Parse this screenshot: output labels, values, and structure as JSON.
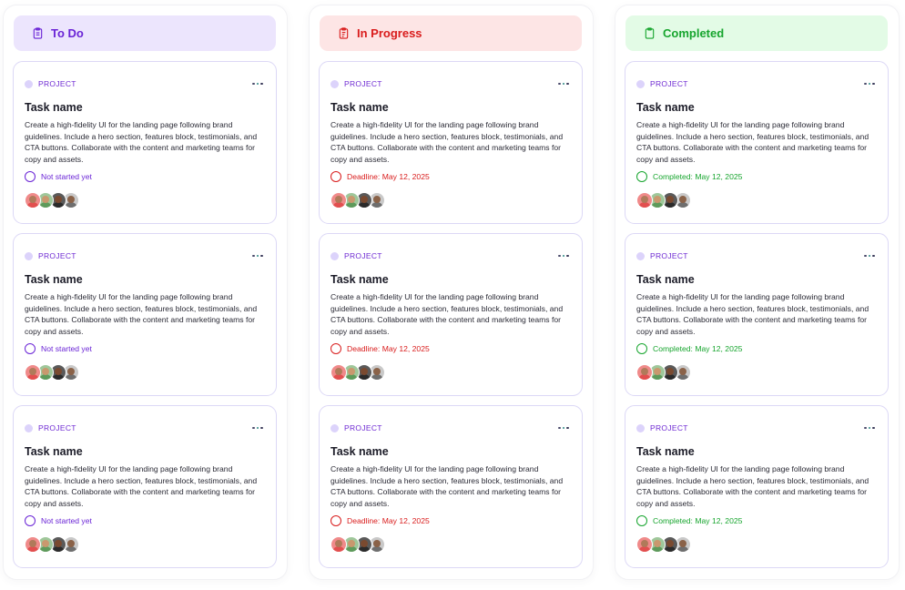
{
  "columns": [
    {
      "title": "To Do",
      "header_bg": "#ece5fd",
      "header_color": "#6a24d6",
      "icon": "clipboard-list-icon",
      "status_color": "#6a24d6",
      "cards": [
        {
          "project_label": "PROJECT",
          "title": "Task name",
          "description": "Create a high-fidelity UI for the landing page following brand guidelines. Include a hero section, features block, testimonials, and CTA buttons. Collaborate with the content and marketing teams for copy and assets.",
          "status": "Not started yet"
        },
        {
          "project_label": "PROJECT",
          "title": "Task name",
          "description": "Create a high-fidelity UI for the landing page following brand guidelines. Include a hero section, features block, testimonials, and CTA buttons. Collaborate with the content and marketing teams for copy and assets.",
          "status": "Not started yet"
        },
        {
          "project_label": "PROJECT",
          "title": "Task name",
          "description": "Create a high-fidelity UI for the landing page following brand guidelines. Include a hero section, features block, testimonials, and CTA buttons. Collaborate with the content and marketing teams for copy and assets.",
          "status": "Not started yet"
        }
      ]
    },
    {
      "title": "In Progress",
      "header_bg": "#fde5e5",
      "header_color": "#d91c1c",
      "icon": "clipboard-edit-icon",
      "status_color": "#d91c1c",
      "cards": [
        {
          "project_label": "PROJECT",
          "title": "Task name",
          "description": "Create a high-fidelity UI for the landing page following brand guidelines. Include a hero section, features block, testimonials, and CTA buttons. Collaborate with the content and marketing teams for copy and assets.",
          "status": "Deadline: May 12, 2025"
        },
        {
          "project_label": "PROJECT",
          "title": "Task name",
          "description": "Create a high-fidelity UI for the landing page following brand guidelines. Include a hero section, features block, testimonials, and CTA buttons. Collaborate with the content and marketing teams for copy and assets.",
          "status": "Deadline: May 12, 2025"
        },
        {
          "project_label": "PROJECT",
          "title": "Task name",
          "description": "Create a high-fidelity UI for the landing page following brand guidelines. Include a hero section, features block, testimonials, and CTA buttons. Collaborate with the content and marketing teams for copy and assets.",
          "status": "Deadline: May 12, 2025"
        }
      ]
    },
    {
      "title": "Completed",
      "header_bg": "#e3fbe6",
      "header_color": "#17a52e",
      "icon": "clipboard-check-icon",
      "status_color": "#17a52e",
      "cards": [
        {
          "project_label": "PROJECT",
          "title": "Task name",
          "description": "Create a high-fidelity UI for the landing page following brand guidelines. Include a hero section, features block, testimonials, and CTA buttons. Collaborate with the content and marketing teams for copy and assets.",
          "status": "Completed: May 12, 2025"
        },
        {
          "project_label": "PROJECT",
          "title": "Task name",
          "description": "Create a high-fidelity UI for the landing page following brand guidelines. Include a hero section, features block, testimonials, and CTA buttons. Collaborate with the content and marketing teams for copy and assets.",
          "status": "Completed: May 12, 2025"
        },
        {
          "project_label": "PROJECT",
          "title": "Task name",
          "description": "Create a high-fidelity UI for the landing page following brand guidelines. Include a hero section, features block, testimonials, and CTA buttons. Collaborate with the content and marketing teams for copy and assets.",
          "status": "Completed: May 12, 2025"
        }
      ]
    }
  ],
  "avatars": [
    {
      "bg": "#f08a8a",
      "face": "#b07a5a",
      "body": "#e24f4f"
    },
    {
      "bg": "#9fc79a",
      "face": "#c9986e",
      "body": "#5e9a5b"
    },
    {
      "bg": "#5a5a5a",
      "face": "#7a4a30",
      "body": "#2b2b2b"
    },
    {
      "bg": "#c9c9c9",
      "face": "#8a6248",
      "body": "#6e6e6e"
    }
  ]
}
